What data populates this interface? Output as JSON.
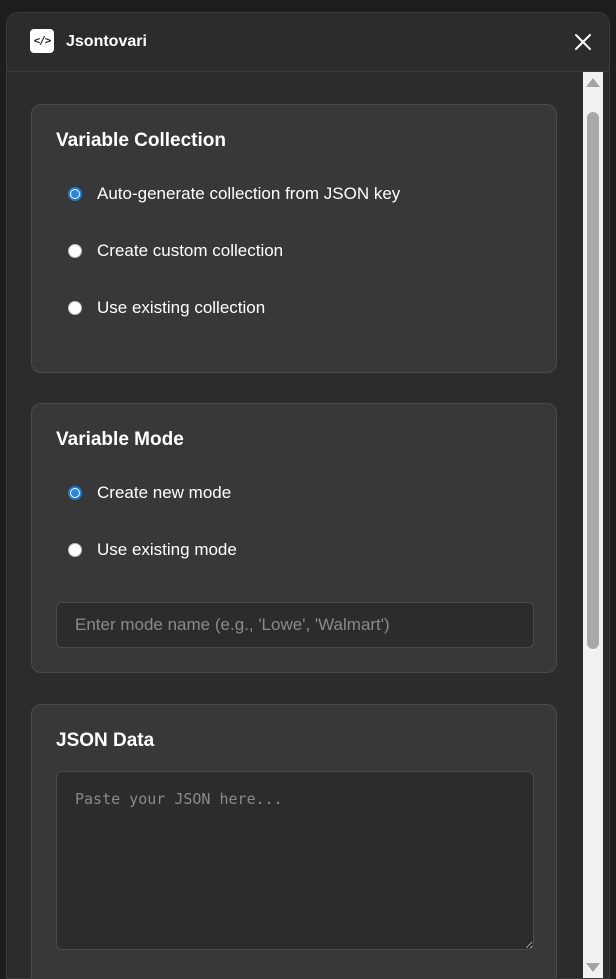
{
  "app": {
    "icon_glyph": "</>",
    "title": "Jsontovari",
    "close_icon": "close-icon"
  },
  "collection": {
    "title": "Variable Collection",
    "options": [
      {
        "label": "Auto-generate collection from JSON key",
        "checked": true
      },
      {
        "label": "Create custom collection",
        "checked": false
      },
      {
        "label": "Use existing collection",
        "checked": false
      }
    ]
  },
  "mode": {
    "title": "Variable Mode",
    "options": [
      {
        "label": "Create new mode",
        "checked": true
      },
      {
        "label": "Use existing mode",
        "checked": false
      }
    ],
    "input_placeholder": "Enter mode name (e.g., 'Lowe', 'Walmart')",
    "input_value": ""
  },
  "json": {
    "title": "JSON Data",
    "placeholder": "Paste your JSON here...",
    "value": ""
  },
  "colors": {
    "accent": "#2d84d8",
    "background": "#2c2c2c",
    "card": "#383838"
  }
}
